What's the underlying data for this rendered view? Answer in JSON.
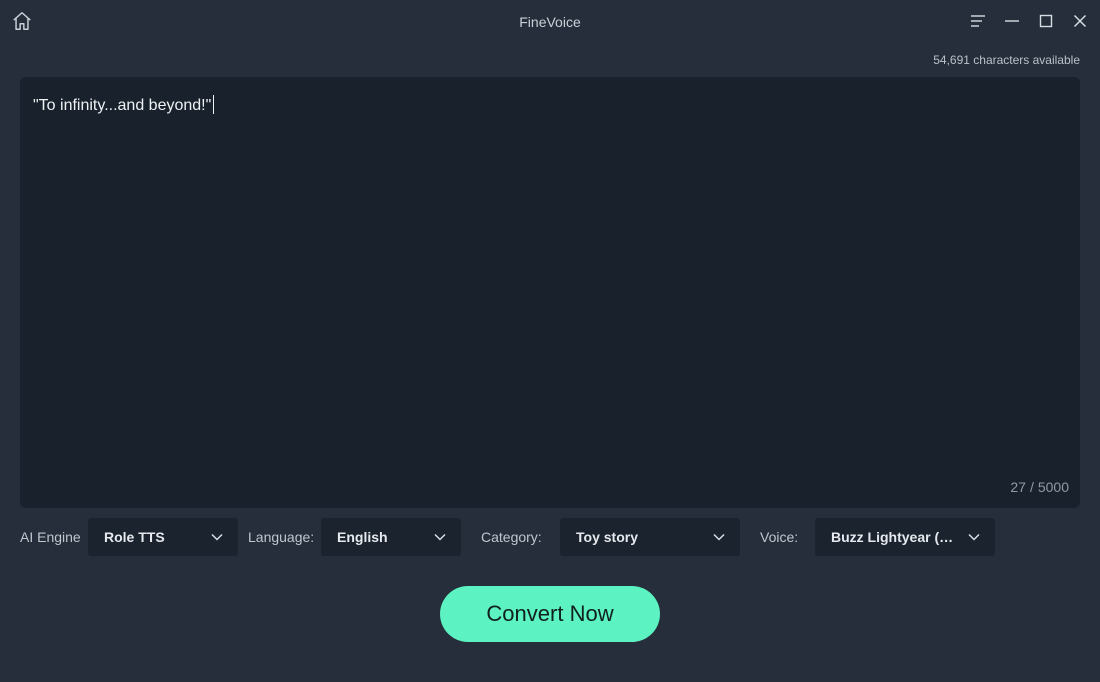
{
  "window": {
    "title": "FineVoice"
  },
  "icons": {
    "home": "home-icon",
    "menu": "hamburger-menu-icon",
    "minimize": "minimize-icon",
    "maximize": "maximize-icon",
    "close": "close-icon",
    "dropdown": "chevron-down-icon"
  },
  "status": {
    "characters_available": "54,691 characters available"
  },
  "editor": {
    "text": "\"To infinity...and beyond!\"",
    "count_current": "27",
    "count_separator": "/",
    "count_max": "5000"
  },
  "options": {
    "engine": {
      "label": "AI Engine",
      "value": "Role TTS"
    },
    "language": {
      "label": "Language:",
      "value": "English"
    },
    "category": {
      "label": "Category:",
      "value": "Toy story"
    },
    "voice": {
      "label": "Voice:",
      "value": "Buzz Lightyear (Ti..."
    }
  },
  "actions": {
    "convert_label": "Convert Now"
  },
  "colors": {
    "background": "#252e3a",
    "editor_background": "#19212c",
    "select_background": "#1b232e",
    "accent": "#5cf2c2"
  }
}
